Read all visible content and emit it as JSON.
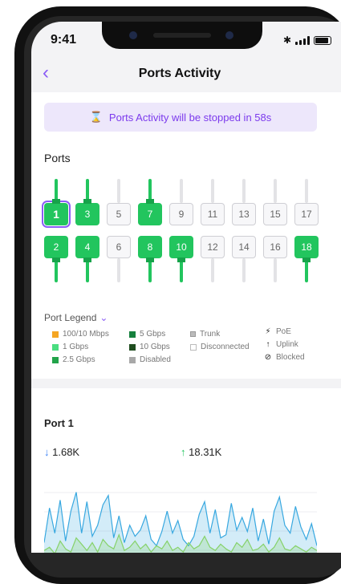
{
  "status_bar": {
    "time": "9:41",
    "bluetooth_icon": "bluetooth-icon",
    "signal_icon": "signal-icon",
    "battery_icon": "battery-icon"
  },
  "nav": {
    "title": "Ports Activity",
    "back_icon": "chevron-left-icon"
  },
  "banner": {
    "icon": "hourglass-icon",
    "text": "Ports Activity will be stopped in 58s"
  },
  "ports_section": {
    "label": "Ports"
  },
  "ports": {
    "top": [
      {
        "label": "1",
        "active": true,
        "selected": true
      },
      {
        "label": "3",
        "active": true,
        "selected": false
      },
      {
        "label": "5",
        "active": false,
        "selected": false
      },
      {
        "label": "7",
        "active": true,
        "selected": false
      },
      {
        "label": "9",
        "active": false,
        "selected": false
      },
      {
        "label": "11",
        "active": false,
        "selected": false
      },
      {
        "label": "13",
        "active": false,
        "selected": false
      },
      {
        "label": "15",
        "active": false,
        "selected": false
      },
      {
        "label": "17",
        "active": false,
        "selected": false
      }
    ],
    "bottom": [
      {
        "label": "2",
        "active": true,
        "selected": false
      },
      {
        "label": "4",
        "active": true,
        "selected": false
      },
      {
        "label": "6",
        "active": false,
        "selected": false
      },
      {
        "label": "8",
        "active": true,
        "selected": false
      },
      {
        "label": "10",
        "active": true,
        "selected": false
      },
      {
        "label": "12",
        "active": false,
        "selected": false
      },
      {
        "label": "14",
        "active": false,
        "selected": false
      },
      {
        "label": "16",
        "active": false,
        "selected": false
      },
      {
        "label": "18",
        "active": true,
        "selected": false
      }
    ]
  },
  "legend": {
    "toggle_label": "Port Legend",
    "speeds": [
      {
        "label": "100/10 Mbps",
        "color": "#f5a623"
      },
      {
        "label": "1 Gbps",
        "color": "#4ade80"
      },
      {
        "label": "2.5 Gbps",
        "color": "#22a34a"
      },
      {
        "label": "5 Gbps",
        "color": "#15803d"
      },
      {
        "label": "10 Gbps",
        "color": "#1f4d1f"
      },
      {
        "label": "Disabled",
        "color": "#a8a8a8"
      }
    ],
    "types": [
      {
        "label": "Trunk",
        "icon": "trunk-icon"
      },
      {
        "label": "Disconnected",
        "icon": "disconnected-icon"
      }
    ],
    "states": [
      {
        "label": "PoE",
        "icon": "bolt-icon",
        "glyph": "⚡"
      },
      {
        "label": "Uplink",
        "icon": "arrow-up-icon",
        "glyph": "↑"
      },
      {
        "label": "Blocked",
        "icon": "blocked-icon",
        "glyph": "⊘"
      }
    ]
  },
  "port_card": {
    "title": "Port 1",
    "down": {
      "arrow": "↓",
      "value": "1.68K"
    },
    "up": {
      "arrow": "↑",
      "value": "18.31K"
    }
  },
  "chart_data": {
    "type": "area",
    "title": "",
    "series": [
      {
        "color": "#38a8e0",
        "values": [
          18,
          62,
          30,
          72,
          20,
          58,
          82,
          30,
          70,
          26,
          40,
          66,
          78,
          24,
          52,
          18,
          40,
          26,
          34,
          52,
          22,
          14,
          32,
          58,
          30,
          46,
          22,
          14,
          26,
          54,
          70,
          30,
          60,
          24,
          28,
          68,
          34,
          50,
          32,
          62,
          20,
          48,
          16,
          58,
          76,
          40,
          30,
          64,
          38,
          22,
          42,
          14
        ]
      },
      {
        "color": "#86d26a",
        "values": [
          8,
          12,
          4,
          20,
          10,
          6,
          24,
          16,
          8,
          18,
          6,
          22,
          14,
          10,
          28,
          8,
          12,
          20,
          10,
          16,
          6,
          14,
          10,
          20,
          8,
          12,
          6,
          18,
          10,
          14,
          26,
          12,
          8,
          16,
          10,
          6,
          18,
          12,
          22,
          8,
          10,
          16,
          6,
          12,
          24,
          10,
          8,
          14,
          10,
          6,
          12,
          8
        ]
      }
    ],
    "ylim": [
      0,
      100
    ],
    "grid": true
  }
}
